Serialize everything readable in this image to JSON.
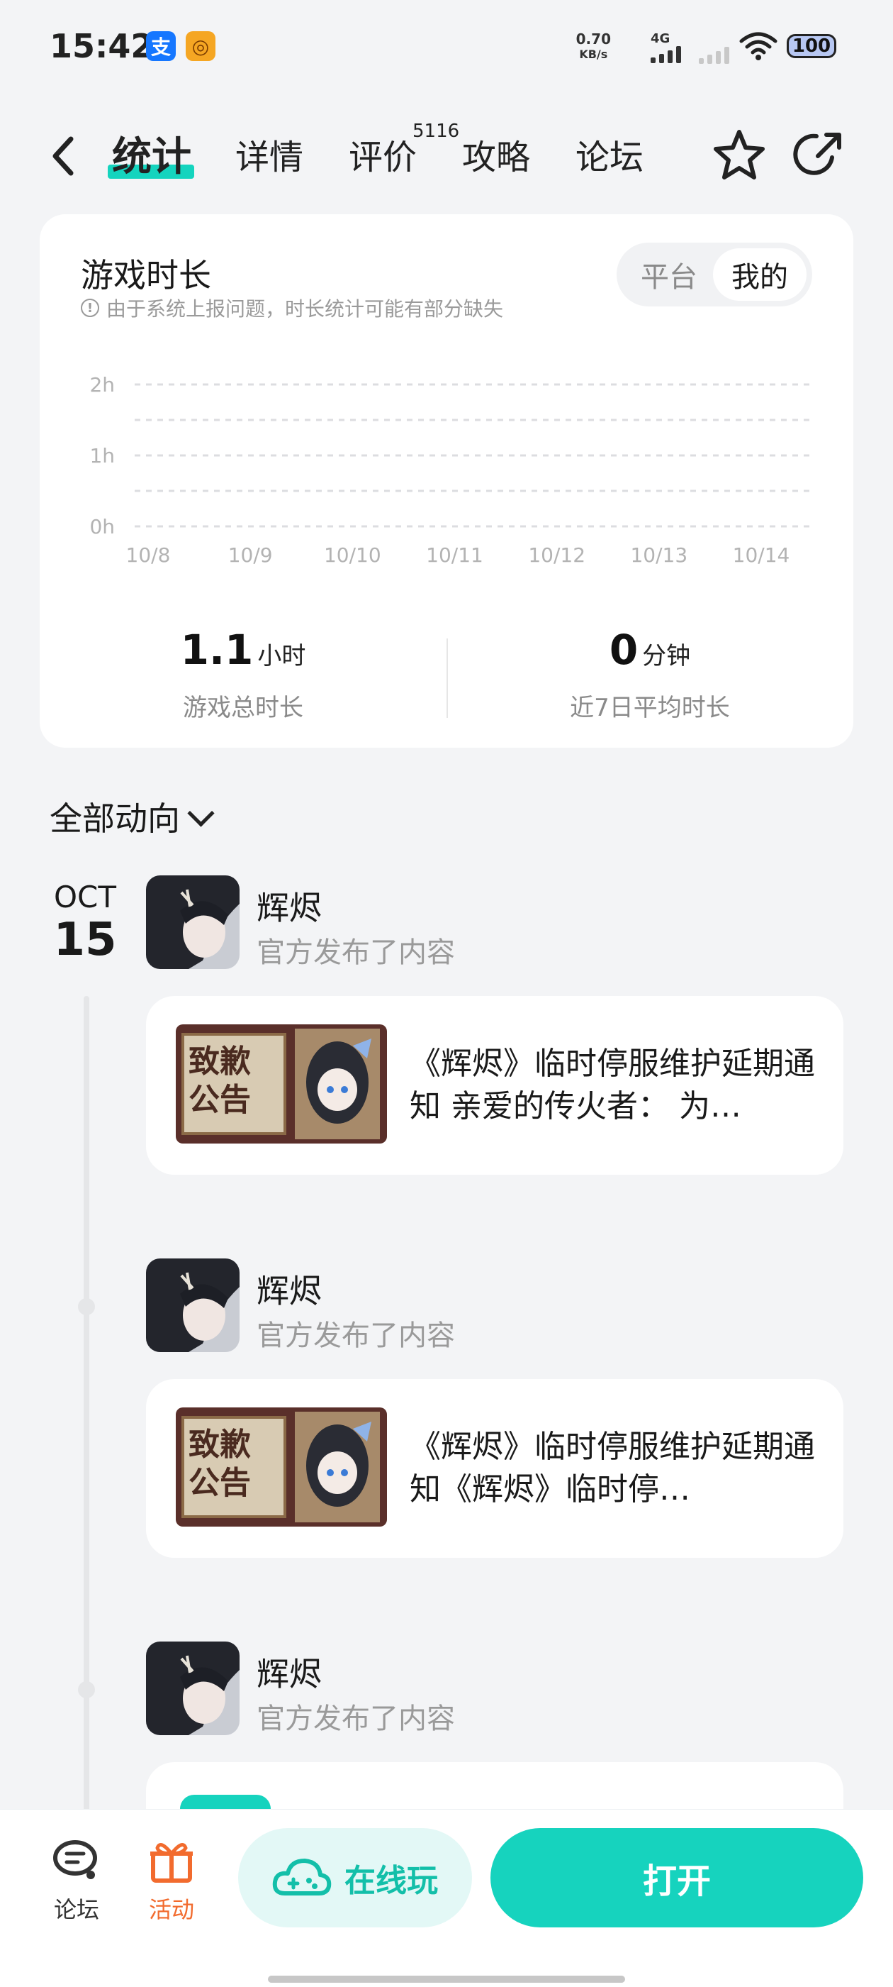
{
  "status_bar": {
    "time": "15:42",
    "app_icons": [
      {
        "icon": "alipay-icon",
        "glyph": "支",
        "color": "#1677ff"
      },
      {
        "icon": "game-app-icon",
        "glyph": "◎",
        "color": "#f5a623"
      }
    ],
    "net_speed_value": "0.70",
    "net_speed_unit": "KB/s",
    "network_type": "4G",
    "battery": "100"
  },
  "nav": {
    "tabs": [
      {
        "label": "统计",
        "active": true
      },
      {
        "label": "详情",
        "active": false
      },
      {
        "label": "评价",
        "active": false
      },
      {
        "label": "攻略",
        "active": false
      },
      {
        "label": "论坛",
        "active": false
      }
    ],
    "review_count": "5116"
  },
  "stats": {
    "title": "游戏时长",
    "notice": "由于系统上报问题，时长统计可能有部分缺失",
    "toggle": {
      "options": [
        "平台",
        "我的"
      ],
      "selected": "我的"
    },
    "total": {
      "value": "1.1",
      "unit": "小时",
      "label": "游戏总时长"
    },
    "avg": {
      "value": "0",
      "unit": "分钟",
      "label": "近7日平均时长"
    }
  },
  "chart_data": {
    "type": "bar",
    "categories": [
      "10/8",
      "10/9",
      "10/10",
      "10/11",
      "10/12",
      "10/13",
      "10/14"
    ],
    "values": [
      0,
      0,
      0,
      0,
      0,
      0,
      0
    ],
    "yticks": [
      "0h",
      "1h",
      "2h"
    ],
    "ylim": [
      0,
      2
    ],
    "grid": true
  },
  "feed": {
    "filter_label": "全部动向",
    "date_month": "OCT",
    "date_day": "15",
    "posts": [
      {
        "author": "辉烬",
        "action": "官方发布了内容",
        "text": "《辉烬》临时停服维护延期通知 亲爱的传火者： 为…",
        "thumb_title_1": "致歉",
        "thumb_title_2": "公告"
      },
      {
        "author": "辉烬",
        "action": "官方发布了内容",
        "text": "《辉烬》临时停服维护延期通知《辉烬》临时停…",
        "thumb_title_1": "致歉",
        "thumb_title_2": "公告"
      },
      {
        "author": "辉烬",
        "action": "官方发布了内容"
      }
    ]
  },
  "bottom_bar": {
    "forum_label": "论坛",
    "activity_label": "活动",
    "online_play_label": "在线玩",
    "open_label": "打开"
  },
  "colors": {
    "accent": "#16d3be",
    "activity": "#f26b2e"
  }
}
